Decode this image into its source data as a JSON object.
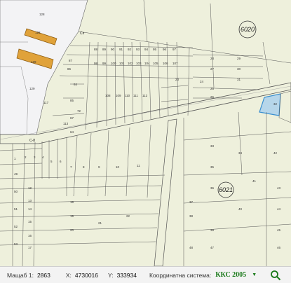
{
  "map": {
    "sheets": [
      "6020",
      "6021"
    ],
    "parcel_labels": [
      "128",
      "128",
      "129",
      "129",
      "117",
      "113",
      "84",
      "85",
      "86",
      "87",
      "88",
      "89",
      "90",
      "91",
      "92",
      "93",
      "94",
      "95",
      "96",
      "97",
      "98",
      "99",
      "100",
      "101",
      "102",
      "103",
      "104",
      "105",
      "106",
      "107",
      "108",
      "109",
      "110",
      "111",
      "112",
      "1",
      "2",
      "3",
      "4",
      "5",
      "6",
      "7",
      "8",
      "9",
      "10",
      "11",
      "12",
      "13",
      "14",
      "15",
      "16",
      "17",
      "18",
      "19",
      "20",
      "21",
      "22",
      "23",
      "24",
      "25",
      "26",
      "27",
      "28",
      "29",
      "30",
      "31",
      "32",
      "33",
      "34",
      "35",
      "36",
      "37",
      "38",
      "39",
      "40",
      "41",
      "42",
      "43",
      "44",
      "45",
      "46",
      "47",
      "48",
      "49",
      "50",
      "51",
      "52",
      "53",
      "72",
      "67",
      "64"
    ],
    "road_labels": [
      "Сп",
      "С-8"
    ],
    "colors": {
      "background": "#eef0dc",
      "parcel_line": "#555555",
      "urban_area": "#f2f2f4",
      "building_fill": "#e0a23a",
      "selected_fill": "#a8cfee",
      "selected_stroke": "#3a8fd0"
    }
  },
  "statusbar": {
    "scale_label": "Мащаб 1:",
    "scale_value": "2863",
    "x_label": "X:",
    "x_value": "4730016",
    "y_label": "Y:",
    "y_value": "333934",
    "crs_label": "Координатна система:",
    "crs_value": "ККС 2005",
    "dropdown_icon": "caret-down-icon",
    "search_icon": "magnifier-icon"
  }
}
